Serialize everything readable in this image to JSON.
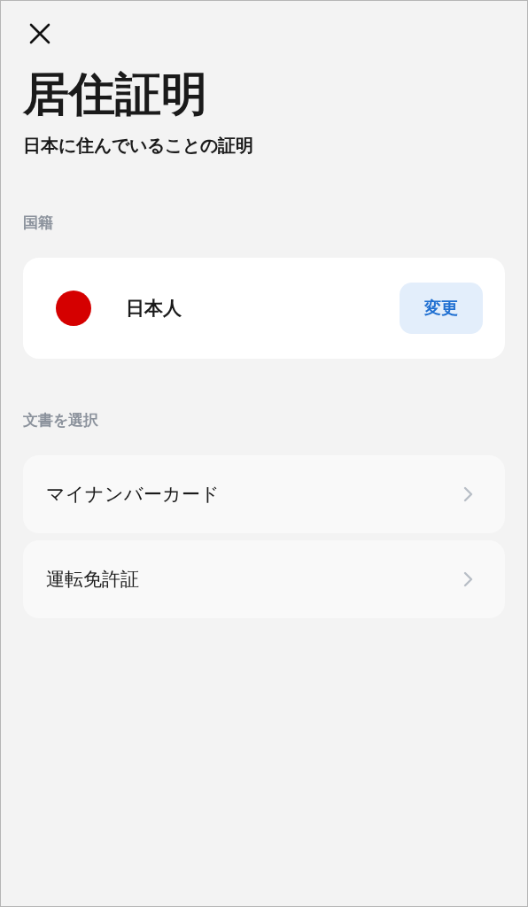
{
  "header": {
    "title": "居住証明",
    "subtitle": "日本に住んでいることの証明"
  },
  "nationality": {
    "label": "国籍",
    "value": "日本人",
    "button": "変更"
  },
  "documents": {
    "label": "文書を選択",
    "items": [
      {
        "label": "マイナンバーカード"
      },
      {
        "label": "運転免許証"
      }
    ]
  }
}
